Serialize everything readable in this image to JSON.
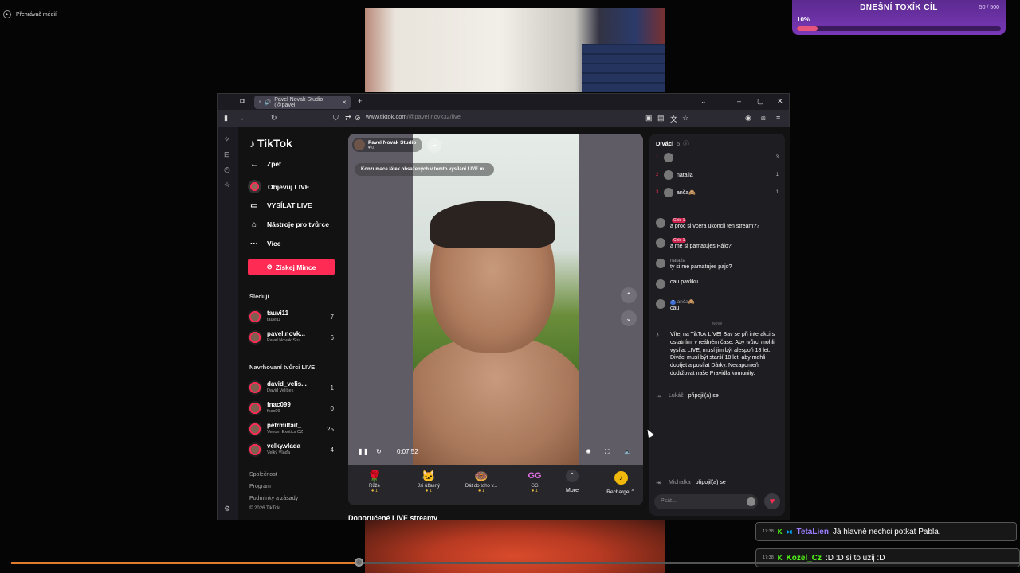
{
  "media_player": {
    "title": "Přehrávač médií",
    "progress_fraction": 0.344
  },
  "goal": {
    "title": "DNEŠNÍ TOXÍK CÍL",
    "count": "50 / 500",
    "percent_label": "10%",
    "fill_fraction": 0.1
  },
  "browser": {
    "tab_title": "Pavel Novak Studio (@pavel",
    "new_tab": "+",
    "url_domain": "www.tiktok.com",
    "url_path": "/@pavel.novk32/live"
  },
  "tiktok": {
    "logo": "TikTok",
    "back": "Zpět",
    "nav": [
      {
        "label": "Objevuj LIVE"
      },
      {
        "label": "VYSÍLAT LIVE"
      },
      {
        "label": "Nástroje pro tvůrce"
      },
      {
        "label": "Více"
      }
    ],
    "coins_button": "Získej Mince",
    "following_title": "Sleduji",
    "following": [
      {
        "name": "tauvi11",
        "sub": "tauvi11",
        "count": "7"
      },
      {
        "name": "pavel.novk...",
        "sub": "Pavel Novak Stu...",
        "count": "6"
      }
    ],
    "suggested_title": "Navrhovaní tvůrci LIVE",
    "suggested": [
      {
        "name": "david_velis...",
        "sub": "David Velíšek",
        "count": "1"
      },
      {
        "name": "fnac099",
        "sub": "fnac09",
        "count": "0"
      },
      {
        "name": "petrmilfait_",
        "sub": "Venom Exotics CZ",
        "count": "25"
      },
      {
        "name": "velky.vlada",
        "sub": "Velký Vláďa",
        "count": "4"
      }
    ],
    "footer": [
      "Společnost",
      "Program",
      "Podmínky a zásady",
      "© 2026 TikTok"
    ],
    "recommended_title": "Doporučené LIVE streamy"
  },
  "player": {
    "host_name": "Pavel Novak Studio",
    "host_likes": "0",
    "warning": "Konzumace látek obsažených v tomto vysílání LIVE m...",
    "time": "0:07:52",
    "gifts": [
      {
        "icon": "🌹",
        "name": "Růže",
        "price": "1"
      },
      {
        "icon": "🐱",
        "name": "Jsi úžasný",
        "price": "1"
      },
      {
        "icon": "🍩",
        "name": "Dát do toho v...",
        "price": "1"
      },
      {
        "icon": "GG",
        "name": "GG",
        "price": "1"
      }
    ],
    "more_label": "More",
    "recharge_label": "Recharge ⌃"
  },
  "chat": {
    "viewers_title": "Diváci",
    "viewers_count": "5",
    "top_viewers": [
      {
        "rank": "1",
        "name": "",
        "value": "3"
      },
      {
        "rank": "2",
        "name": "natalia",
        "value": "1"
      },
      {
        "rank": "3",
        "name": "anča🙈",
        "value": "1"
      }
    ],
    "messages": [
      {
        "name": "",
        "badge": "Chlo 1",
        "text": "a proc si vcera ukoncil ten stream??"
      },
      {
        "name": "",
        "badge": "Chlo 1",
        "text": "a me si pamatujes Pájo?"
      },
      {
        "name": "natalia",
        "badge": "",
        "text": "ty si me pamatujes pajo?"
      },
      {
        "name": "",
        "badge": "",
        "text": "cau pavliku"
      },
      {
        "name": "anča🙈",
        "badge": "7",
        "text": "cau"
      }
    ],
    "new_label": "Nové",
    "system_message": "Vítej na TikTok LIVE! Bav se při interakci s ostatními v reálném čase. Aby tvůrci mohli vysílat LIVE, musí jim být alespoň 18 let. Diváci musí být starší 18 let, aby mohli dobíjet a posílat Dárky. Nezapomeň dodržovat naše Pravidla komunity.",
    "joined": [
      {
        "name": "Lukáš",
        "text": "připojil(a) se"
      },
      {
        "name": "Michalka",
        "text": "připojil(a) se"
      }
    ],
    "input_placeholder": "Psát..."
  },
  "overlay_chat": [
    {
      "time": "17:38",
      "name": "TetaLien",
      "name_color": "#9b7dff",
      "text": "Já hlavně nechci potkat Pabla."
    },
    {
      "time": "17:38",
      "name": "Kozel_Cz",
      "name_color": "#53fc18",
      "text": ":D :D si to uzij :D"
    }
  ]
}
